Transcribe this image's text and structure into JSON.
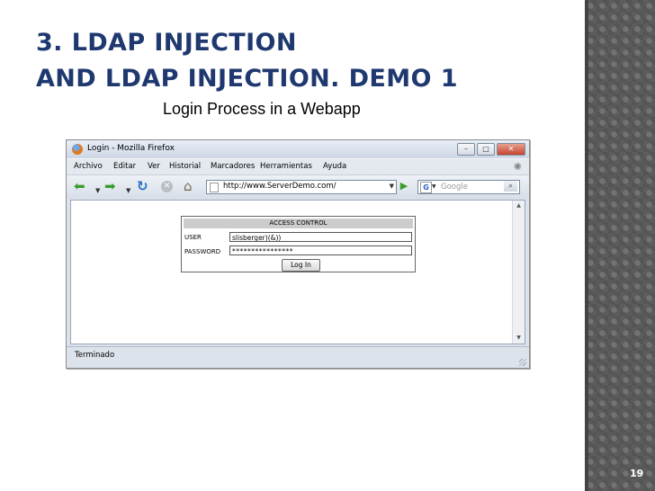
{
  "slide": {
    "title_line1": "3. LDAP INJECTION",
    "title_line2": "AND LDAP INJECTION. DEMO 1",
    "subtitle": "Login Process in a Webapp",
    "page_number": "19"
  },
  "browser": {
    "window_title": "Login - Mozilla Firefox",
    "window_buttons": {
      "minimize": "–",
      "maximize": "□",
      "close": "✕"
    },
    "menu": [
      "Archivo",
      "Editar",
      "Ver",
      "Historial",
      "Marcadores",
      "Herramientas",
      "Ayuda"
    ],
    "url": "http://www.ServerDemo.com/",
    "search_placeholder": "Google",
    "status": "Terminado"
  },
  "form": {
    "header": "ACCESS CONTROL",
    "user_label": "USER",
    "user_value": "slisberger)(&))",
    "password_label": "PASSWORD",
    "password_value": "****************",
    "button": "Log In"
  },
  "icons": {
    "back": "back-arrow-icon",
    "forward": "forward-arrow-icon",
    "reload": "reload-icon",
    "stop": "stop-icon",
    "home": "home-icon",
    "go": "go-icon",
    "search": "magnifier-icon"
  },
  "colors": {
    "title": "#1f3970",
    "side_strip": "#5c5c5c",
    "page_number": "#ffffff"
  }
}
